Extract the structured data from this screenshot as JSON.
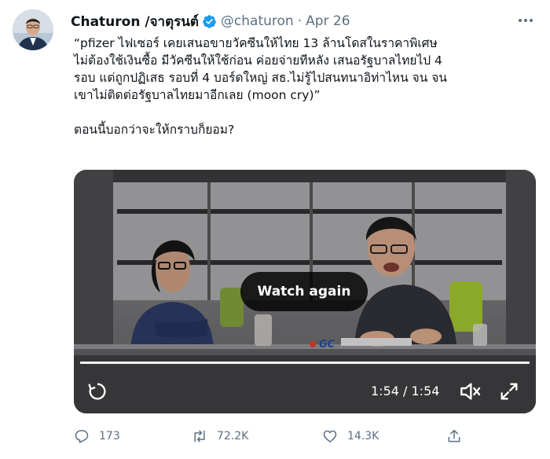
{
  "author": {
    "display_name": "Chaturon /จาตุรนต์",
    "handle": "@chaturon",
    "separator": "·",
    "date": "Apr 26",
    "verified": true
  },
  "tweet": {
    "lines": [
      "“pfizer ไฟเซอร์ เคยเสนอขายวัคซีนให้ไทย 13 ล้านโดสในราคาพิเศษ",
      "ไม่ต้องใช้เงินซื้อ มีวัคซีนให้ใช้ก่อน ค่อยจ่ายทีหลัง เสนอรัฐบาลไทยไป 4",
      "รอบ แต่ถูกปฏิเสธ รอบที่ 4 บอร์ดใหญ่ สธ.ไม่รู้ไปสนทนาอิท่าไหน จน จน",
      "เขาไม่ติดต่อรัฐบาลไทยมาอีกเลย (moon cry)”"
    ],
    "second_paragraph": "ตอนนี้บอกว่าจะให้กราบก็ยอม?"
  },
  "video": {
    "watch_again_label": "Watch again",
    "time_display": "1:54 / 1:54",
    "progress": 1.0,
    "logo_text": "GC"
  },
  "actions": {
    "replies": "173",
    "retweets": "72.2K",
    "likes": "14.3K"
  },
  "colors": {
    "verified_blue": "#1d9bf0",
    "secondary_text": "#5b7083",
    "primary_text": "#0f1419"
  },
  "icons": [
    "verified-badge-icon",
    "more-icon",
    "replay-icon",
    "volume-icon",
    "fullscreen-icon",
    "reply-icon",
    "retweet-icon",
    "like-icon",
    "share-icon"
  ]
}
